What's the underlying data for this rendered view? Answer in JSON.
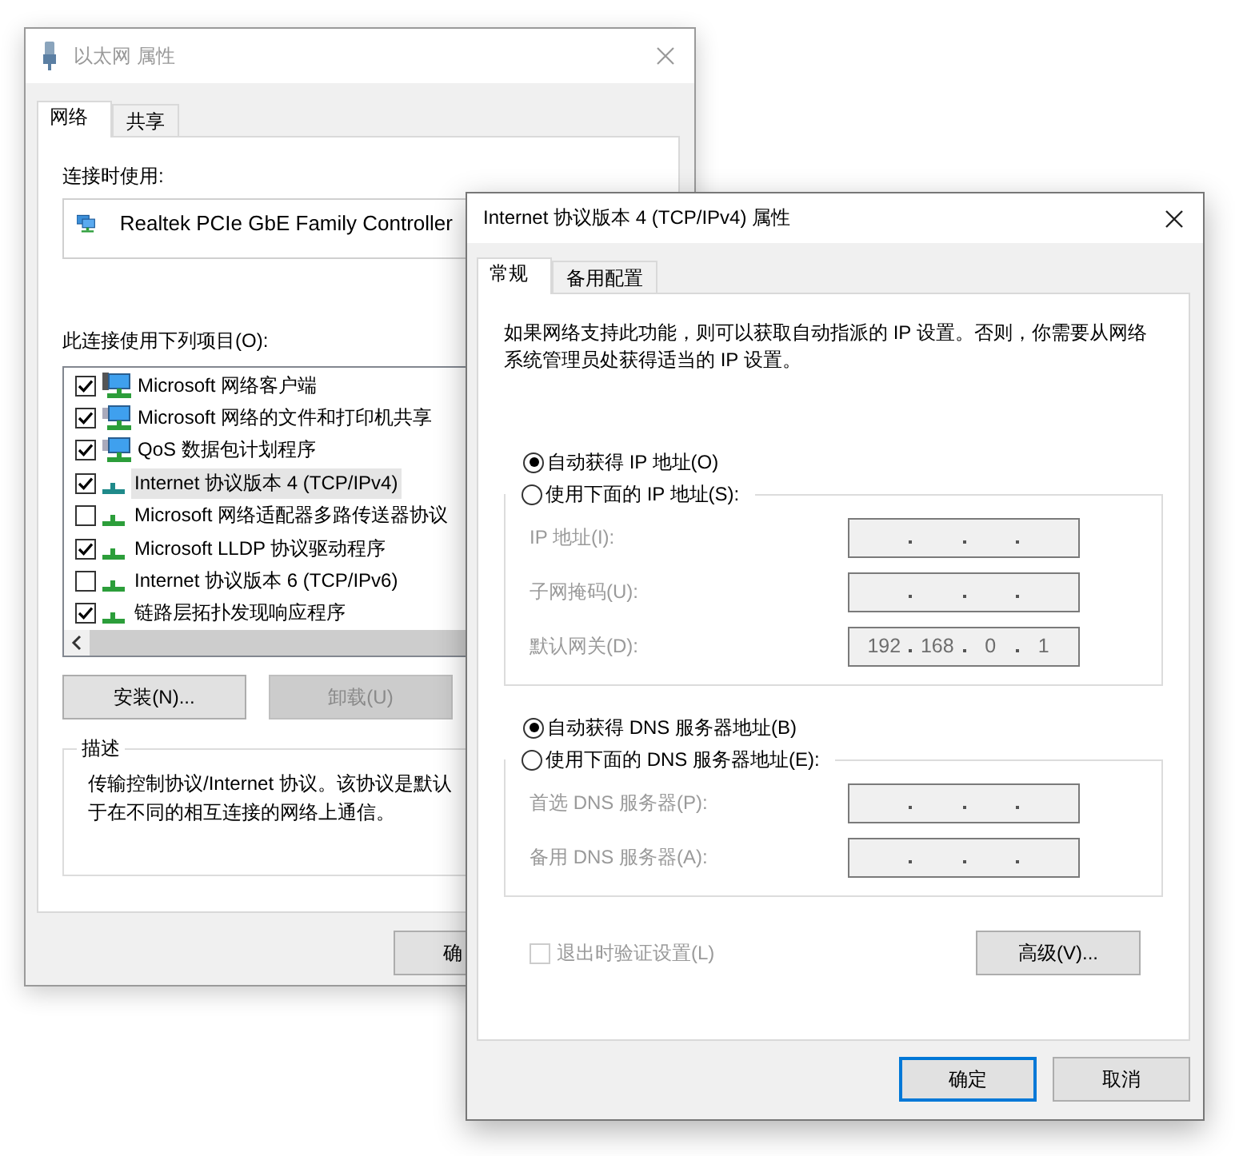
{
  "ethernet_window": {
    "title": "以太网 属性",
    "tabs": [
      {
        "label": "网络",
        "selected": true
      },
      {
        "label": "共享",
        "selected": false
      }
    ],
    "connect_using_label": "连接时使用:",
    "adapter": "Realtek PCIe GbE Family Controller",
    "items_label": "此连接使用下列项目(O):",
    "items": [
      {
        "kind": "client",
        "label": "Microsoft 网络客户端",
        "checked": true,
        "selected": false
      },
      {
        "kind": "service",
        "label": "Microsoft 网络的文件和打印机共享",
        "checked": true,
        "selected": false
      },
      {
        "kind": "service",
        "label": "QoS 数据包计划程序",
        "checked": true,
        "selected": false
      },
      {
        "kind": "protocol",
        "label": "Internet 协议版本 4 (TCP/IPv4)",
        "checked": true,
        "selected": true
      },
      {
        "kind": "protocol",
        "label": "Microsoft 网络适配器多路传送器协议",
        "checked": false,
        "selected": false
      },
      {
        "kind": "protocol",
        "label": "Microsoft LLDP 协议驱动程序",
        "checked": true,
        "selected": false
      },
      {
        "kind": "protocol",
        "label": "Internet 协议版本 6 (TCP/IPv6)",
        "checked": false,
        "selected": false
      },
      {
        "kind": "protocol",
        "label": "链路层拓扑发现响应程序",
        "checked": true,
        "selected": false
      }
    ],
    "buttons": [
      {
        "label": "安装(N)...",
        "disabled": false
      },
      {
        "label": "卸载(U)",
        "disabled": true
      }
    ],
    "description": {
      "title": "描述",
      "lines": [
        "传输控制协议/Internet 协议。该协议是默认",
        "于在不同的相互连接的网络上通信。"
      ]
    },
    "ok_button": "确"
  },
  "ipv4_window": {
    "title": "Internet 协议版本 4 (TCP/IPv4) 属性",
    "tabs": [
      {
        "label": "常规",
        "selected": true
      },
      {
        "label": "备用配置",
        "selected": false
      }
    ],
    "intro": "如果网络支持此功能，则可以获取自动指派的 IP 设置。否则，你需要从网络系统管理员处获得适当的 IP 设置。",
    "sections": [
      {
        "options": [
          {
            "label": "自动获得 IP 地址(O)",
            "selected": true
          },
          {
            "label": "使用下面的 IP 地址(S):",
            "selected": false
          }
        ],
        "disabled": true,
        "fields": [
          {
            "label": "IP 地址(I):"
          },
          {
            "label": "子网掩码(U):"
          },
          {
            "label": "默认网关(D):",
            "octets": [
              "192",
              "168",
              "0",
              "1"
            ]
          }
        ]
      },
      {
        "options": [
          {
            "label": "自动获得 DNS 服务器地址(B)",
            "selected": true
          },
          {
            "label": "使用下面的 DNS 服务器地址(E):",
            "selected": false
          }
        ],
        "disabled": true,
        "fields": [
          {
            "label": "首选 DNS 服务器(P):"
          },
          {
            "label": "备用 DNS 服务器(A):"
          }
        ]
      }
    ],
    "validate_checkbox": {
      "label": "退出时验证设置(L)",
      "checked": false,
      "disabled": true
    },
    "advanced_button": "高级(V)...",
    "buttons": [
      {
        "label": "确定",
        "default": true
      },
      {
        "label": "取消",
        "default": false
      }
    ]
  }
}
